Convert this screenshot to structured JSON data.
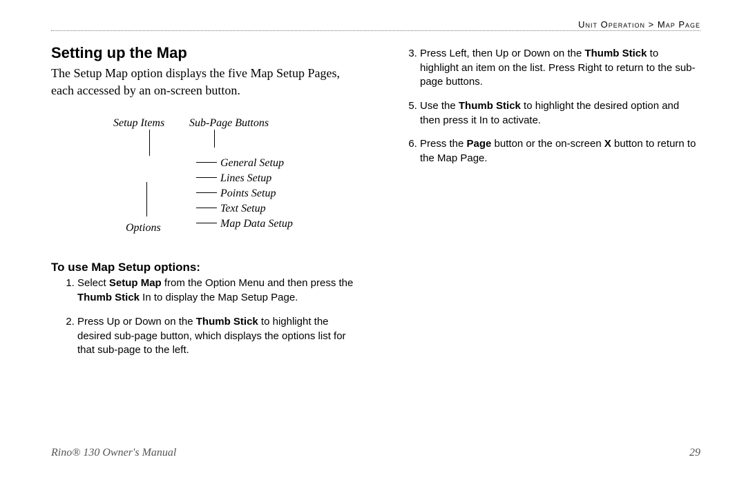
{
  "breadcrumb": {
    "section": "Unit Operation",
    "sep": " > ",
    "page": "Map Page"
  },
  "left": {
    "title": "Setting up the Map",
    "intro": "The Setup Map option displays the five Map Setup Pages, each accessed by an on-screen button.",
    "diagram": {
      "setup_items": "Setup Items",
      "subpage_buttons": "Sub-Page Buttons",
      "options": "Options",
      "items": {
        "general": "General Setup",
        "lines": "Lines Setup",
        "points": "Points Setup",
        "text": "Text Setup",
        "mapdata": "Map Data Setup"
      }
    },
    "subhead": "To use Map Setup options:",
    "steps": {
      "s1a": "Select ",
      "s1b": "Setup Map",
      "s1c": " from the Option Menu    and then press the ",
      "s1d": "Thumb Stick",
      "s1e": " In to display the Map Setup Page.",
      "s2a": "Press Up or Down on the ",
      "s2b": "Thumb Stick",
      "s2c": " to highlight the desired sub-page button, which displays the options list for that sub-page to the left."
    }
  },
  "right": {
    "steps": {
      "s3a": "Press Left, then Up or Down on the ",
      "s3b": "Thumb Stick",
      "s3c": " to highlight an item on the list. Press Right to return to the sub-page buttons.",
      "s5a": "Use the ",
      "s5b": "Thumb Stick",
      "s5c": " to highlight the desired option and then press it In to activate.",
      "s6a": "Press the ",
      "s6b": "Page",
      "s6c": " button or the on-screen ",
      "s6d": "X",
      "s6e": " button to return to the Map Page."
    }
  },
  "footer": {
    "product": "Rino® 130 Owner's Manual",
    "page_number": "29"
  }
}
